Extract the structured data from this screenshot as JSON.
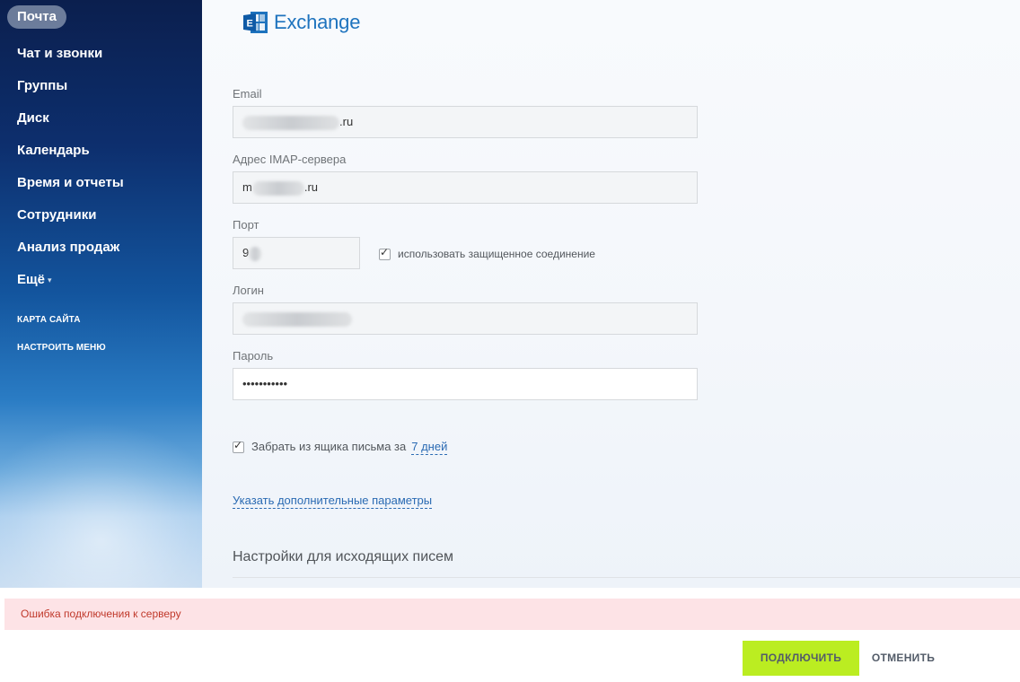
{
  "sidebar": {
    "items": [
      {
        "label": "Почта",
        "active": true
      },
      {
        "label": "Чат и звонки"
      },
      {
        "label": "Группы"
      },
      {
        "label": "Диск"
      },
      {
        "label": "Календарь"
      },
      {
        "label": "Время и отчеты"
      },
      {
        "label": "Сотрудники"
      },
      {
        "label": "Анализ продаж"
      },
      {
        "label": "Ещё"
      }
    ],
    "links": [
      "КАРТА САЙТА",
      "НАСТРОИТЬ МЕНЮ"
    ]
  },
  "header": {
    "logo_text": "Exchange",
    "logo_icon": "exchange-logo-icon"
  },
  "form": {
    "email": {
      "label": "Email",
      "value_suffix": ".ru"
    },
    "imap": {
      "label": "Адрес IMAP-сервера",
      "value_prefix": "m",
      "value_suffix": ".ru"
    },
    "port": {
      "label": "Порт",
      "value_prefix": "9"
    },
    "secure": {
      "label": "использовать защищенное соединение",
      "checked": true
    },
    "login": {
      "label": "Логин"
    },
    "password": {
      "label": "Пароль",
      "value": "•••••••••••"
    },
    "fetch": {
      "label": "Забрать из ящика письма за",
      "period": "7 дней",
      "checked": true
    },
    "more_params": "Указать дополнительные параметры",
    "outgoing_title": "Настройки для исходящих писем"
  },
  "error": {
    "message": "Ошибка подключения к серверу"
  },
  "footer": {
    "connect_label": "ПОДКЛЮЧИТЬ",
    "cancel_label": "ОТМЕНИТЬ"
  },
  "colors": {
    "accent_green": "#bbed21",
    "link_blue": "#2a6ab3",
    "error_bg": "#fde3e6",
    "error_text": "#c0392b"
  }
}
